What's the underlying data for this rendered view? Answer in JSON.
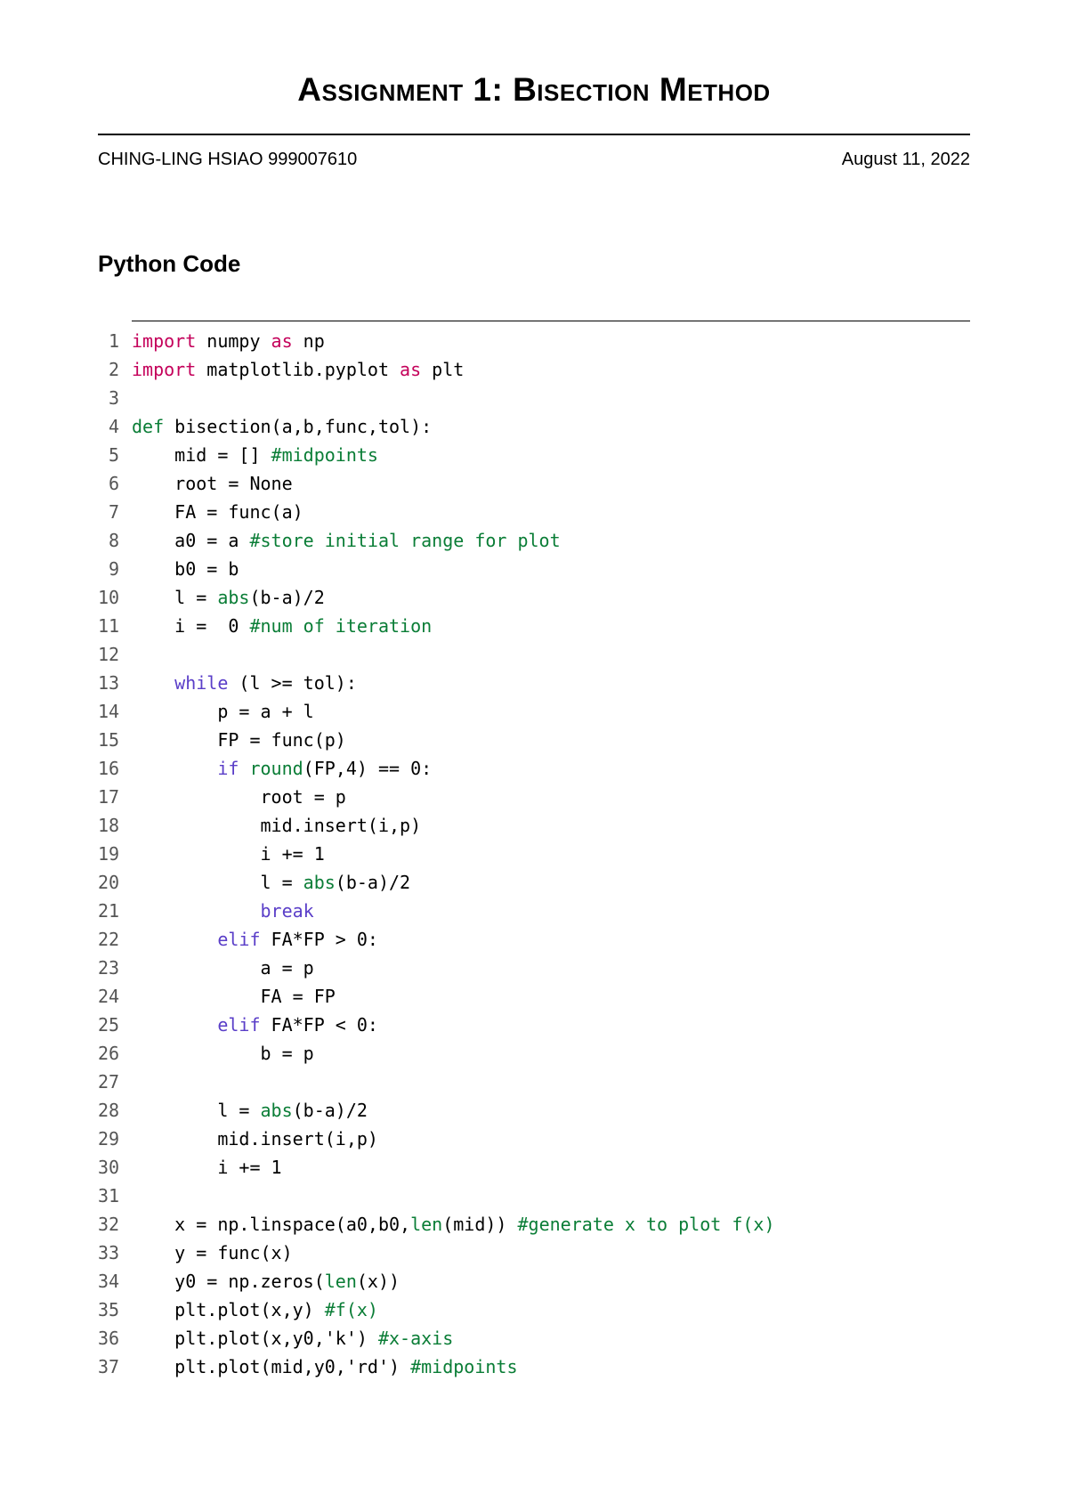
{
  "document": {
    "title_prefix": "A",
    "title_word1": "ssignment",
    "title_num": " 1: ",
    "title_prefix2": "B",
    "title_word2": "isection",
    "title_prefix3": " M",
    "title_word3": "ethod",
    "author": "CHING-LING HSIAO 999007610",
    "date": "August 11, 2022",
    "section": "Python Code"
  },
  "code": {
    "lines": [
      [
        {
          "t": "import ",
          "c": "kw-import"
        },
        {
          "t": "numpy "
        },
        {
          "t": "as ",
          "c": "kw-import"
        },
        {
          "t": "np"
        }
      ],
      [
        {
          "t": "import ",
          "c": "kw-import"
        },
        {
          "t": "matplotlib.pyplot "
        },
        {
          "t": "as ",
          "c": "kw-import"
        },
        {
          "t": "plt"
        }
      ],
      [],
      [
        {
          "t": "def ",
          "c": "kw-def"
        },
        {
          "t": "bisection(a,b,func,tol):"
        }
      ],
      [
        {
          "t": "    mid = [] "
        },
        {
          "t": "#midpoints",
          "c": "comment"
        }
      ],
      [
        {
          "t": "    root = None"
        }
      ],
      [
        {
          "t": "    FA = func(a)"
        }
      ],
      [
        {
          "t": "    a0 = a "
        },
        {
          "t": "#store initial range for plot",
          "c": "comment"
        }
      ],
      [
        {
          "t": "    b0 = b"
        }
      ],
      [
        {
          "t": "    l = "
        },
        {
          "t": "abs",
          "c": "builtin"
        },
        {
          "t": "(b-a)/2"
        }
      ],
      [
        {
          "t": "    i =  0 "
        },
        {
          "t": "#num of iteration",
          "c": "comment"
        }
      ],
      [],
      [
        {
          "t": "    "
        },
        {
          "t": "while ",
          "c": "kw-flow"
        },
        {
          "t": "(l >= tol):"
        }
      ],
      [
        {
          "t": "        p = a + l"
        }
      ],
      [
        {
          "t": "        FP = func(p)"
        }
      ],
      [
        {
          "t": "        "
        },
        {
          "t": "if ",
          "c": "kw-flow"
        },
        {
          "t": "round",
          "c": "builtin"
        },
        {
          "t": "(FP,4) == 0:"
        }
      ],
      [
        {
          "t": "            root = p"
        }
      ],
      [
        {
          "t": "            mid.insert(i,p)"
        }
      ],
      [
        {
          "t": "            i += 1"
        }
      ],
      [
        {
          "t": "            l = "
        },
        {
          "t": "abs",
          "c": "builtin"
        },
        {
          "t": "(b-a)/2"
        }
      ],
      [
        {
          "t": "            "
        },
        {
          "t": "break",
          "c": "kw-flow"
        }
      ],
      [
        {
          "t": "        "
        },
        {
          "t": "elif ",
          "c": "kw-flow"
        },
        {
          "t": "FA*FP > 0:"
        }
      ],
      [
        {
          "t": "            a = p"
        }
      ],
      [
        {
          "t": "            FA = FP"
        }
      ],
      [
        {
          "t": "        "
        },
        {
          "t": "elif ",
          "c": "kw-flow"
        },
        {
          "t": "FA*FP < 0:"
        }
      ],
      [
        {
          "t": "            b = p"
        }
      ],
      [],
      [
        {
          "t": "        l = "
        },
        {
          "t": "abs",
          "c": "builtin"
        },
        {
          "t": "(b-a)/2"
        }
      ],
      [
        {
          "t": "        mid.insert(i,p)"
        }
      ],
      [
        {
          "t": "        i += 1"
        }
      ],
      [],
      [
        {
          "t": "    x = np.linspace(a0,b0,"
        },
        {
          "t": "len",
          "c": "builtin"
        },
        {
          "t": "(mid)) "
        },
        {
          "t": "#generate x to plot f(x)",
          "c": "comment"
        }
      ],
      [
        {
          "t": "    y = func(x)"
        }
      ],
      [
        {
          "t": "    y0 = np.zeros("
        },
        {
          "t": "len",
          "c": "builtin"
        },
        {
          "t": "(x))"
        }
      ],
      [
        {
          "t": "    plt.plot(x,y) "
        },
        {
          "t": "#f(x)",
          "c": "comment"
        }
      ],
      [
        {
          "t": "    plt.plot(x,y0,'k') "
        },
        {
          "t": "#x-axis",
          "c": "comment"
        }
      ],
      [
        {
          "t": "    plt.plot(mid,y0,'rd') "
        },
        {
          "t": "#midpoints",
          "c": "comment"
        }
      ]
    ]
  }
}
